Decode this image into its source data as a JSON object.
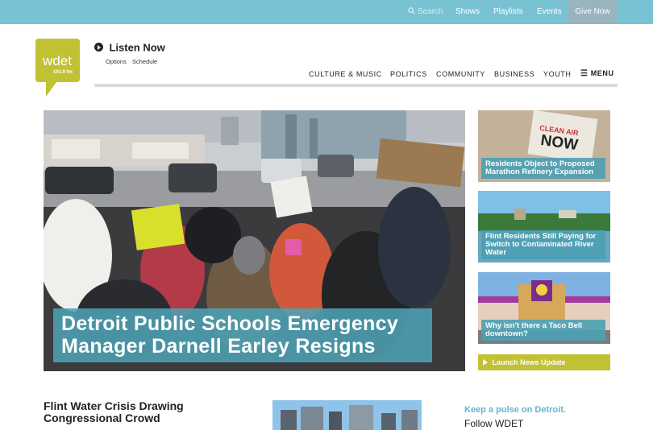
{
  "topbar": {
    "search_label": "Search",
    "shows": "Shows",
    "playlists": "Playlists",
    "events": "Events",
    "give_now": "Give Now"
  },
  "logo": {
    "name": "wdet",
    "freq": "101.9 fm",
    "color": "#c0c234"
  },
  "listen": {
    "title": "Listen Now",
    "options": "Options",
    "schedule": "Schedule"
  },
  "nav": {
    "items": [
      "CULTURE & MUSIC",
      "POLITICS",
      "COMMUNITY",
      "BUSINESS",
      "YOUTH"
    ],
    "menu": "MENU"
  },
  "hero": {
    "headline": "Detroit Public Schools Emergency Manager Darnell Earley Resigns"
  },
  "side_stories": [
    {
      "title": "Residents Object to Proposed Marathon Refinery Expansion",
      "sign_text": "CLEAN AIR NOW"
    },
    {
      "title": "Flint Residents Still Paying for Switch to Contaminated River Water"
    },
    {
      "title": "Why isn’t there a Taco Bell downtown?"
    }
  ],
  "launch": {
    "label": "Launch News Update"
  },
  "bottom": {
    "story_title": "Flint Water Crisis Drawing Congressional Crowd",
    "pulse": "Keep a pulse on Detroit.",
    "follow": "Follow WDET"
  },
  "colors": {
    "topbar": "#79c2d3",
    "accent": "#4da0b4",
    "logo": "#c0c234",
    "give": "#9ab4bd"
  }
}
